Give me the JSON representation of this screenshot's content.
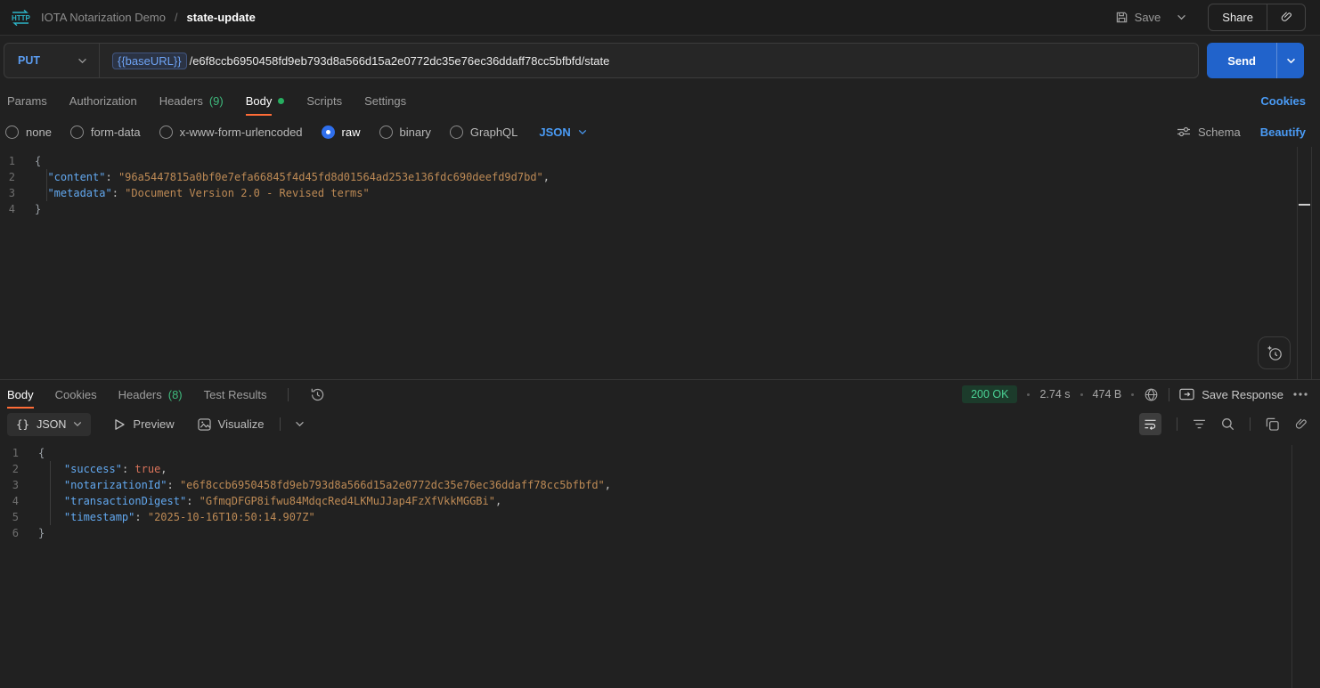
{
  "header": {
    "collection_name": "IOTA Notarization Demo",
    "separator": "/",
    "request_name": "state-update",
    "save_label": "Save",
    "share_label": "Share"
  },
  "request": {
    "method": "PUT",
    "url_variable": "{{baseURL}}",
    "url_path": "/e6f8ccb6950458fd9eb793d8a566d15a2e0772dc35e76ec36ddaff78cc5bfbfd/state",
    "send_label": "Send",
    "cookies_link": "Cookies",
    "tabs": [
      {
        "label": "Params"
      },
      {
        "label": "Authorization"
      },
      {
        "label": "Headers",
        "count": "(9)"
      },
      {
        "label": "Body",
        "active": true,
        "dot": true
      },
      {
        "label": "Scripts"
      },
      {
        "label": "Settings"
      }
    ],
    "body_types": [
      {
        "label": "none"
      },
      {
        "label": "form-data"
      },
      {
        "label": "x-www-form-urlencoded"
      },
      {
        "label": "raw",
        "selected": true
      },
      {
        "label": "binary"
      },
      {
        "label": "GraphQL"
      }
    ],
    "raw_language": "JSON",
    "schema_label": "Schema",
    "beautify_label": "Beautify",
    "body_lines": [
      {
        "num": "1",
        "tokens": [
          [
            "p",
            "{"
          ]
        ]
      },
      {
        "num": "2",
        "tokens": [
          [
            "c",
            "  "
          ],
          [
            "k",
            "\"content\""
          ],
          [
            "c",
            ": "
          ],
          [
            "s",
            "\"96a5447815a0bf0e7efa66845f4d45fd8d01564ad253e136fdc690deefd9d7bd\""
          ],
          [
            "c",
            ","
          ]
        ]
      },
      {
        "num": "3",
        "tokens": [
          [
            "c",
            "  "
          ],
          [
            "k",
            "\"metadata\""
          ],
          [
            "c",
            ": "
          ],
          [
            "s",
            "\"Document Version 2.0 - Revised terms\""
          ]
        ]
      },
      {
        "num": "4",
        "tokens": [
          [
            "p",
            "}"
          ]
        ]
      }
    ]
  },
  "response": {
    "tabs": [
      {
        "label": "Body",
        "active": true
      },
      {
        "label": "Cookies"
      },
      {
        "label": "Headers",
        "count": "(8)"
      },
      {
        "label": "Test Results"
      }
    ],
    "status": "200 OK",
    "time": "2.74 s",
    "size": "474 B",
    "save_response_label": "Save Response",
    "format": "JSON",
    "braces_glyph": "{}",
    "preview_label": "Preview",
    "visualize_label": "Visualize",
    "body_lines": [
      {
        "num": "1",
        "tokens": [
          [
            "p",
            "{"
          ]
        ]
      },
      {
        "num": "2",
        "tokens": [
          [
            "c",
            "    "
          ],
          [
            "k",
            "\"success\""
          ],
          [
            "c",
            ": "
          ],
          [
            "b",
            "true"
          ],
          [
            "c",
            ","
          ]
        ]
      },
      {
        "num": "3",
        "tokens": [
          [
            "c",
            "    "
          ],
          [
            "k",
            "\"notarizationId\""
          ],
          [
            "c",
            ": "
          ],
          [
            "s",
            "\"e6f8ccb6950458fd9eb793d8a566d15a2e0772dc35e76ec36ddaff78cc5bfbfd\""
          ],
          [
            "c",
            ","
          ]
        ]
      },
      {
        "num": "4",
        "tokens": [
          [
            "c",
            "    "
          ],
          [
            "k",
            "\"transactionDigest\""
          ],
          [
            "c",
            ": "
          ],
          [
            "s",
            "\"GfmqDFGP8ifwu84MdqcRed4LKMuJJap4FzXfVkkMGGBi\""
          ],
          [
            "c",
            ","
          ]
        ]
      },
      {
        "num": "5",
        "tokens": [
          [
            "c",
            "    "
          ],
          [
            "k",
            "\"timestamp\""
          ],
          [
            "c",
            ": "
          ],
          [
            "s",
            "\"2025-10-16T10:50:14.907Z\""
          ]
        ]
      },
      {
        "num": "6",
        "tokens": [
          [
            "p",
            "}"
          ]
        ]
      }
    ]
  },
  "colors": {
    "accent_orange": "#ff6c37",
    "link_blue": "#4a9bf5",
    "method_blue": "#5b9cf0",
    "send_button": "#2163cb",
    "count_green": "#3fba7d",
    "status_text": "#4ad295",
    "status_bg": "#1c3b2b",
    "code_key": "#62a8ef",
    "code_string": "#bd8a55",
    "code_boolean": "#d9735a",
    "http_logo_teal": "#2cb5c8"
  }
}
